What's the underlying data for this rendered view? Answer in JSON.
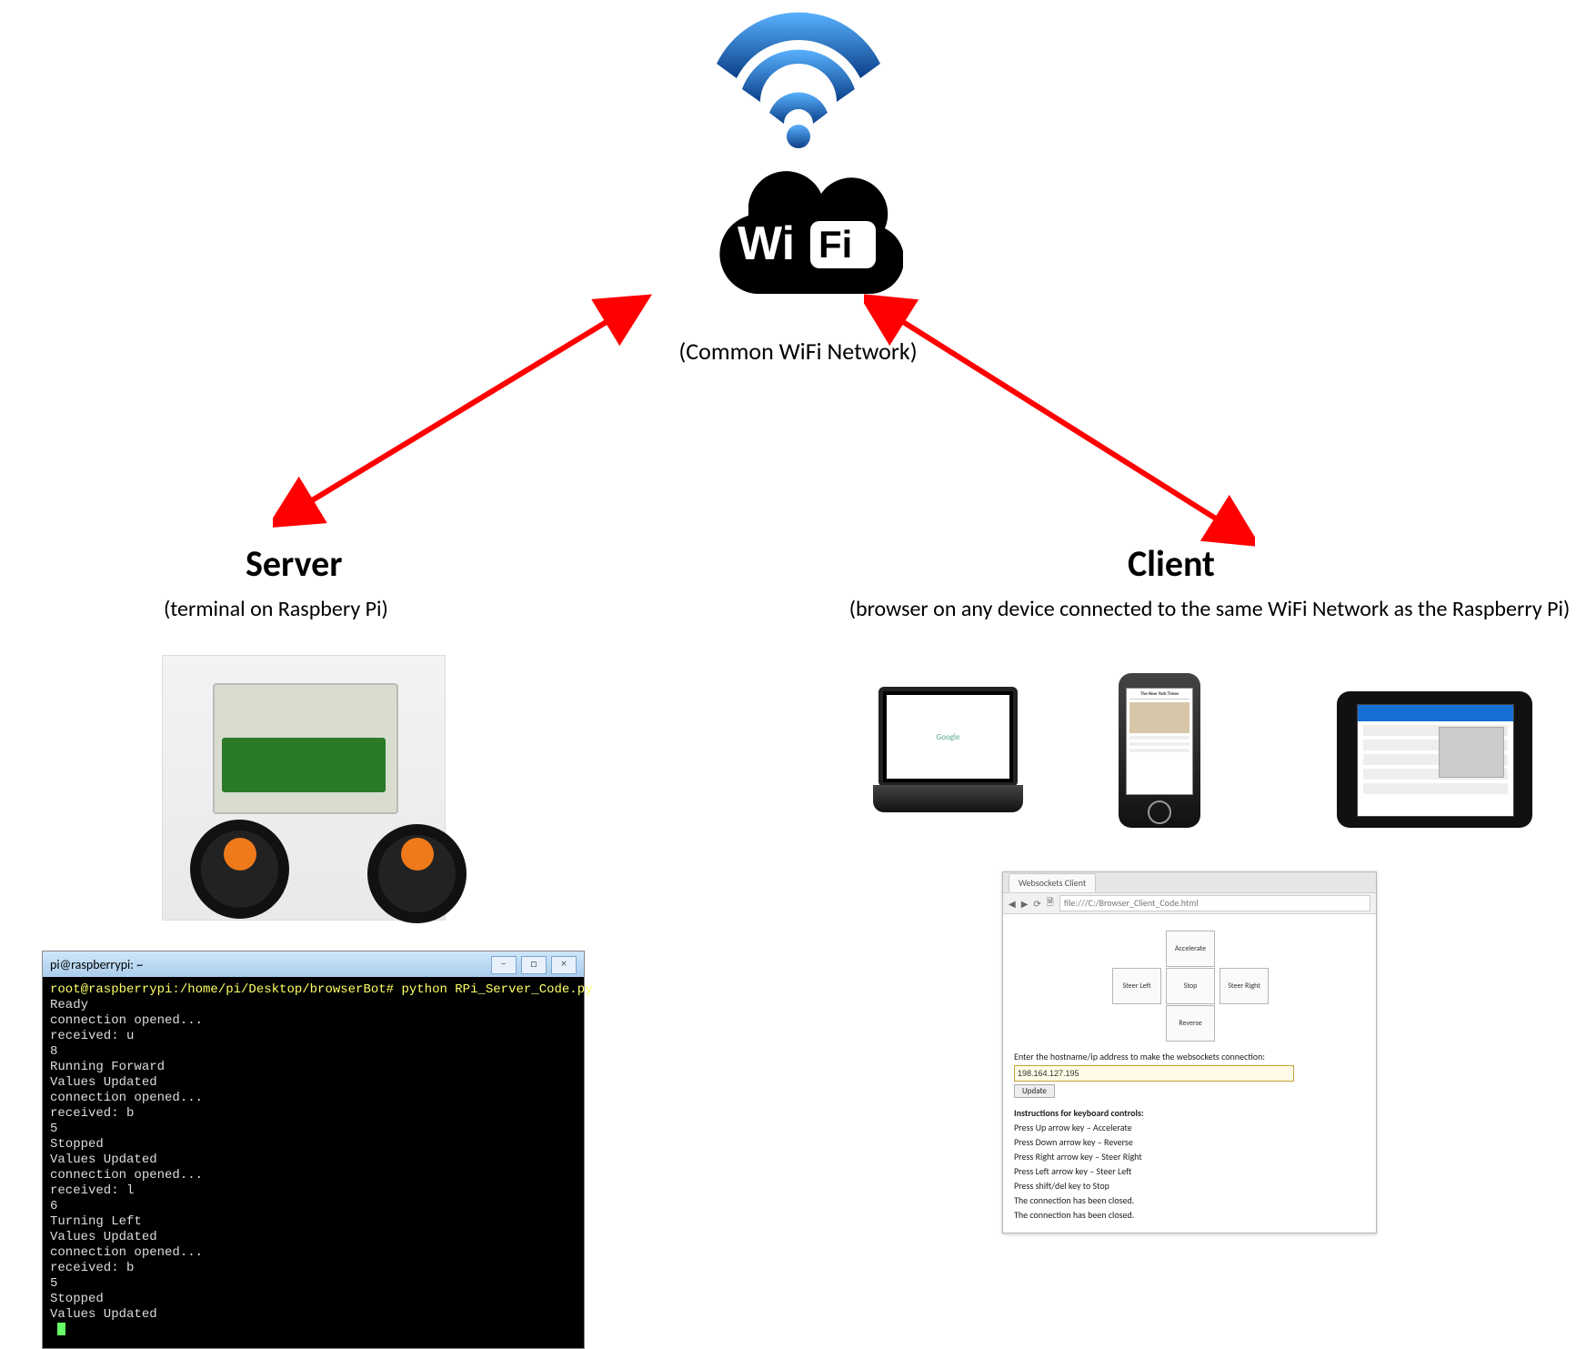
{
  "wifi": {
    "caption": "(Common WiFi Network)",
    "logoText": "Wi Fi"
  },
  "server": {
    "title": "Server",
    "subtitle": "(terminal on Raspbery Pi)",
    "terminal": {
      "windowTitle": "pi@raspberrypi: ~",
      "lines": [
        {
          "cls": "y",
          "t": "root@raspberrypi:/home/pi/Desktop/browserBot# python RPi_Server_Code.py"
        },
        {
          "cls": "",
          "t": "Ready"
        },
        {
          "cls": "",
          "t": "connection opened..."
        },
        {
          "cls": "",
          "t": "received: u"
        },
        {
          "cls": "",
          "t": "8"
        },
        {
          "cls": "",
          "t": "Running Forward"
        },
        {
          "cls": "",
          "t": "Values Updated"
        },
        {
          "cls": "",
          "t": "connection opened..."
        },
        {
          "cls": "",
          "t": "received: b"
        },
        {
          "cls": "",
          "t": "5"
        },
        {
          "cls": "",
          "t": "Stopped"
        },
        {
          "cls": "",
          "t": "Values Updated"
        },
        {
          "cls": "",
          "t": "connection opened..."
        },
        {
          "cls": "",
          "t": "received: l"
        },
        {
          "cls": "",
          "t": "6"
        },
        {
          "cls": "",
          "t": "Turning Left"
        },
        {
          "cls": "",
          "t": "Values Updated"
        },
        {
          "cls": "",
          "t": "connection opened..."
        },
        {
          "cls": "",
          "t": "received: b"
        },
        {
          "cls": "",
          "t": "5"
        },
        {
          "cls": "",
          "t": "Stopped"
        },
        {
          "cls": "",
          "t": "Values Updated"
        }
      ]
    }
  },
  "client": {
    "title": "Client",
    "subtitle": "(browser on any device connected to the same WiFi Network as the Raspberry Pi)",
    "devices": {
      "laptopPage": "Google",
      "phoneHeader": "The New York Times"
    },
    "browser": {
      "tabTitle": "Websockets Client",
      "url": "file:///C:/Browser_Client_Code.html",
      "controls": {
        "up": "Accelerate",
        "left": "Steer Left",
        "center": "Stop",
        "right": "Steer Right",
        "down": "Reverse"
      },
      "prompt": "Enter the hostname/ip address to make the websockets connection:",
      "ipValue": "198.164.127.195",
      "updateBtn": "Update",
      "instructionsTitle": "Instructions for keyboard controls:",
      "instructions": [
        "Press Up arrow key – Accelerate",
        "Press Down arrow key – Reverse",
        "Press Right arrow key – Steer Right",
        "Press Left arrow key – Steer Left",
        "Press shift/del key to Stop",
        "The connection has been closed.",
        "The connection has been closed."
      ]
    }
  },
  "colors": {
    "arrow": "#ff0000",
    "wifiBlue": "#1a6fd4",
    "wifiDark": "#0b3f87"
  }
}
